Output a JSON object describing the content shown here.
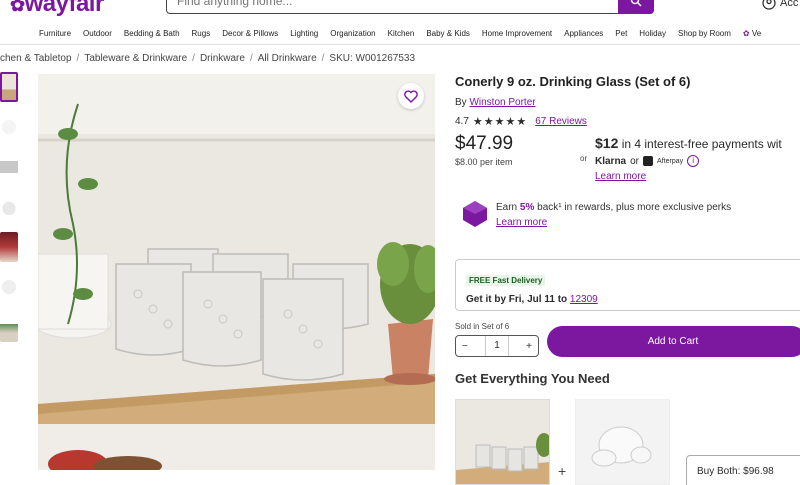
{
  "header": {
    "logo": "wayfair",
    "search_placeholder": "Find anything home...",
    "account_label": "Acc"
  },
  "nav": [
    "Furniture",
    "Outdoor",
    "Bedding & Bath",
    "Rugs",
    "Decor & Pillows",
    "Lighting",
    "Organization",
    "Kitchen",
    "Baby & Kids",
    "Home Improvement",
    "Appliances",
    "Pet",
    "Holiday",
    "Shop by Room",
    "Ve"
  ],
  "breadcrumb": [
    "chen & Tabletop",
    "Tableware & Drinkware",
    "Drinkware",
    "All Drinkware"
  ],
  "sku": "SKU: W001267533",
  "product": {
    "title": "Conerly 9 oz. Drinking Glass (Set of 6)",
    "by_prefix": "By",
    "brand": "Winston Porter",
    "rating": "4.7",
    "stars": "★★★★★",
    "reviews": "67 Reviews",
    "price": "$47.99",
    "unit_price": "$8.00 per item",
    "or": "or",
    "klarna_amount": "$12",
    "klarna_text": "in 4 interest-free payments wit",
    "klarna_brand": "Klarna",
    "afterpay": "Afterpay",
    "learn_more": "Learn more",
    "rewards_earn": "Earn",
    "rewards_pct": "5%",
    "rewards_rest": "back¹ in rewards, plus more exclusive perks",
    "rewards_learn": "Learn more"
  },
  "delivery": {
    "badge": "FREE Fast Delivery",
    "get_it": "Get it by Fri, Jul 11 to",
    "zip": "12309"
  },
  "purchase": {
    "sold_in": "Sold in Set of 6",
    "qty": "1",
    "minus": "−",
    "plus": "+",
    "add_to_cart": "Add to Cart"
  },
  "bundle": {
    "heading": "Get Everything You Need",
    "plus": "+",
    "buy_both": "Buy Both: $96.98"
  },
  "colors": {
    "accent": "#7b189f"
  }
}
